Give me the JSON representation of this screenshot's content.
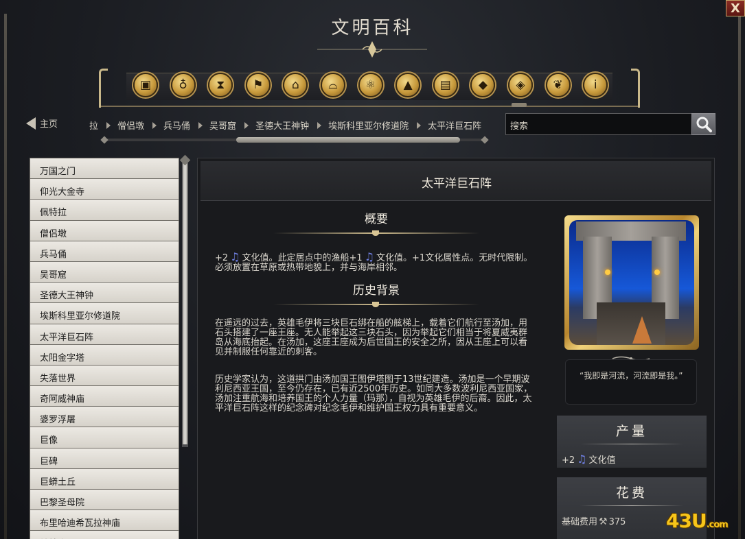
{
  "window": {
    "title": "文明百科",
    "close_label": "X"
  },
  "categories": [
    {
      "name": "cube-icon",
      "glyph": "▣"
    },
    {
      "name": "cup-icon",
      "glyph": "♁"
    },
    {
      "name": "hourglass-icon",
      "glyph": "⧗"
    },
    {
      "name": "flag-icon",
      "glyph": "⚑"
    },
    {
      "name": "temple-icon",
      "glyph": "⌂"
    },
    {
      "name": "book-icon",
      "glyph": "⌓"
    },
    {
      "name": "atom-icon",
      "glyph": "⚛"
    },
    {
      "name": "mountain-icon",
      "glyph": "▲"
    },
    {
      "name": "city-icon",
      "glyph": "▤"
    },
    {
      "name": "diamond-icon",
      "glyph": "◆"
    },
    {
      "name": "pages-icon",
      "glyph": "◈"
    },
    {
      "name": "dove-icon",
      "glyph": "❦"
    },
    {
      "name": "info-icon",
      "glyph": "i"
    }
  ],
  "nav": {
    "home_label": "主页",
    "breadcrumbs": [
      "拉",
      "僧侣墩",
      "兵马俑",
      "吴哥窟",
      "圣德大王神钟",
      "埃斯科里亚尔修道院",
      "太平洋巨石阵"
    ],
    "search_placeholder": "搜索"
  },
  "wonder_list": [
    "万国之门",
    "仰光大金寺",
    "佩特拉",
    "僧侣墩",
    "兵马俑",
    "吴哥窟",
    "圣德大王神钟",
    "埃斯科里亚尔修道院",
    "太平洋巨石阵",
    "太阳金字塔",
    "失落世界",
    "奇阿威神庙",
    "婆罗浮屠",
    "巨像",
    "巨碑",
    "巨蟒土丘",
    "巴黎圣母院",
    "布里哈迪希瓦拉神庙",
    "帕特农"
  ],
  "article": {
    "title": "太平洋巨石阵",
    "summary_heading": "概要",
    "summary_parts": {
      "a": "+2",
      "b": "文化值。此定居点中的渔船+1",
      "c": "文化值。+1文化属性点。无时代限制。必须放置在草原或热带地貌上，并与海岸相邻。"
    },
    "history_heading": "历史背景",
    "history_p1": "在遥远的过去，英雄毛伊将三块巨石绑在船的舷梯上，载着它们航行至汤加，用石头搭建了一座王座。无人能举起这三块石头，因为举起它们相当于将夏威夷群岛从海底抬起。在汤加，这座王座成为后世国王的安全之所，因从王座上可以看见并制服任何靠近的刺客。",
    "history_p2": "历史学家认为，这道拱门由汤加国王图伊塔图于13世纪建造。汤加是一个早期波利尼西亚王国，至今仍存在，已有近2500年历史。如同大多数波利尼西亚国家，汤加注重航海和培养国王的个人力量（玛那），自视为英雄毛伊的后裔。因此，太平洋巨石阵这样的纪念碑对纪念毛伊和维护国王权力具有重要意义。"
  },
  "sidebar": {
    "quote": "“我即是河流，河流即是我。”",
    "yield_heading": "产量",
    "yield_amount": "+2",
    "yield_label": "文化值",
    "cost_heading": "花费",
    "cost_label": "基础费用",
    "cost_value": "375"
  },
  "watermark": {
    "main": "43U",
    "suffix": ".com"
  },
  "colors": {
    "accent_gold": "#c9b88a",
    "culture_note": "#6f7fe0",
    "watermark": "#f7c51a"
  }
}
